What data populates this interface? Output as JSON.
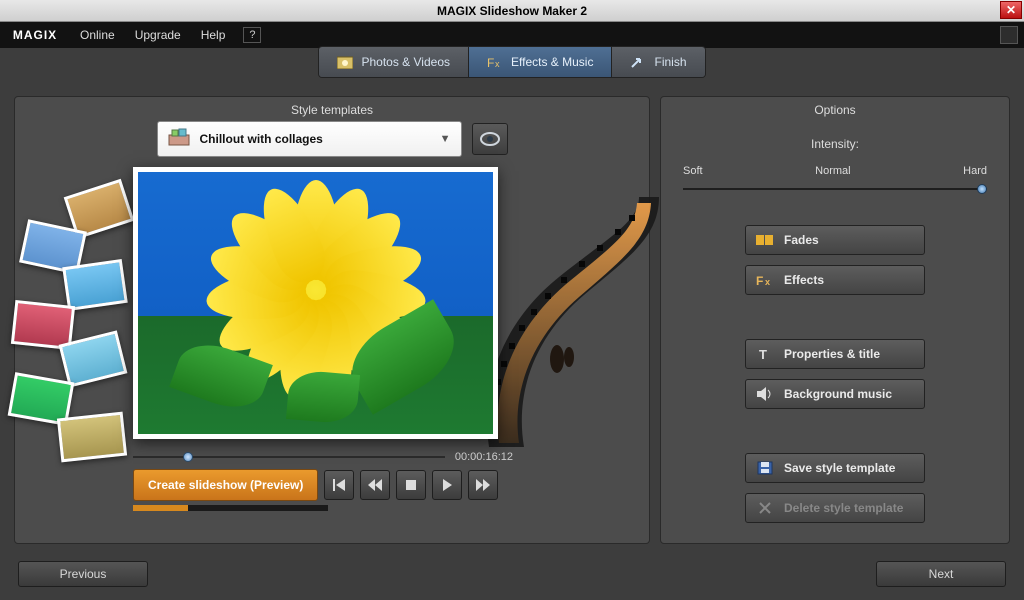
{
  "window": {
    "title": "MAGIX Slideshow Maker 2"
  },
  "brand": "MAGIX",
  "menu": {
    "items": [
      "Online",
      "Upgrade",
      "Help"
    ]
  },
  "tabs": [
    {
      "label": "Photos & Videos",
      "icon": "photo-icon"
    },
    {
      "label": "Effects & Music",
      "icon": "fx-icon"
    },
    {
      "label": "Finish",
      "icon": "export-icon"
    }
  ],
  "active_tab_index": 1,
  "left_panel": {
    "title": "Style templates",
    "dropdown": {
      "selected": "Chillout with collages"
    },
    "timecode": "00:00:16:12",
    "create_button": "Create slideshow (Preview)"
  },
  "right_panel": {
    "title": "Options",
    "intensity": {
      "label": "Intensity:",
      "min_label": "Soft",
      "mid_label": "Normal",
      "max_label": "Hard",
      "value": 1.0
    },
    "buttons": {
      "fades": "Fades",
      "effects": "Effects",
      "properties": "Properties & title",
      "music": "Background music",
      "save": "Save style template",
      "delete": "Delete style template"
    }
  },
  "footer": {
    "prev": "Previous",
    "next": "Next"
  }
}
